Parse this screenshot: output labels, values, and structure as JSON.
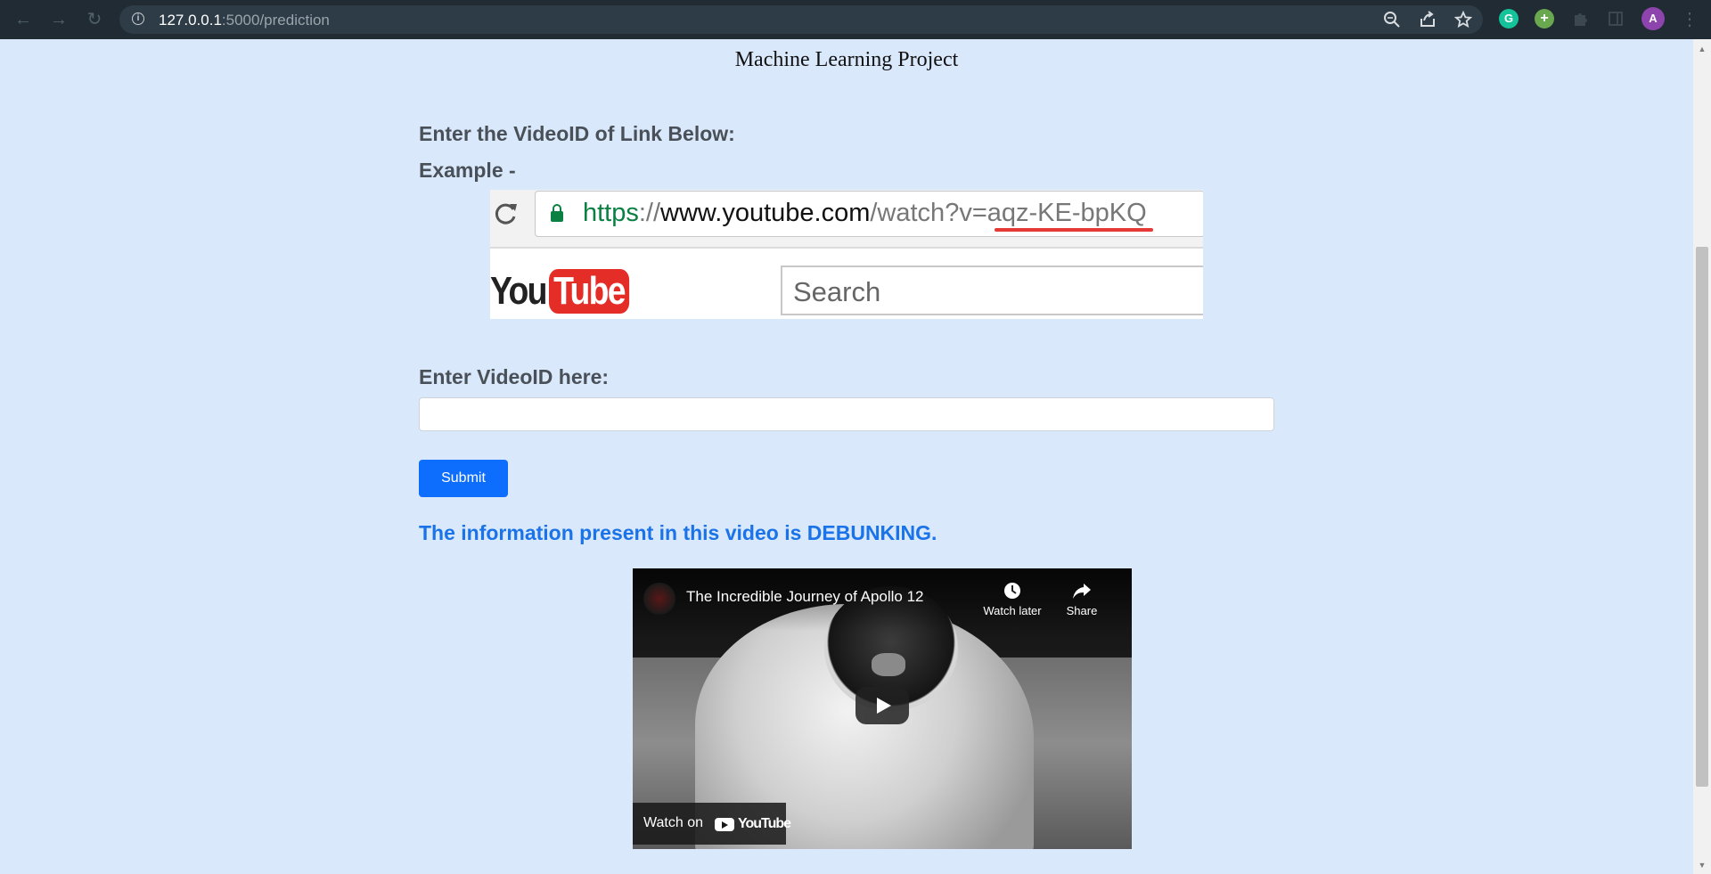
{
  "browser": {
    "url_host": "127.0.0.1",
    "url_rest": ":5000/prediction",
    "profile_initial": "A",
    "extension_grammarly": "G"
  },
  "page": {
    "title": "Machine Learning Project",
    "enter_label": "Enter the VideoID of Link Below:",
    "example_label": "Example -",
    "input_label": "Enter VideoID here:",
    "input_value": "",
    "submit_label": "Submit",
    "result_text": "The information present in this video is DEBUNKING."
  },
  "example_image": {
    "url_https": "https",
    "url_sep": "://",
    "url_host": "www.youtube.com",
    "url_path": "/watch?v=aqz-KE-bpKQ",
    "logo_you": "You",
    "logo_tube": "Tube",
    "search_placeholder": "Search"
  },
  "video": {
    "title": "The Incredible Journey of Apollo 12",
    "watch_later": "Watch later",
    "share": "Share",
    "watch_on": "Watch on",
    "youtube_word": "YouTube"
  },
  "colors": {
    "page_background": "#dae8fc",
    "submit_button": "#0d6efd",
    "result_text": "#1a73e8",
    "youtube_red": "#e52d27"
  }
}
